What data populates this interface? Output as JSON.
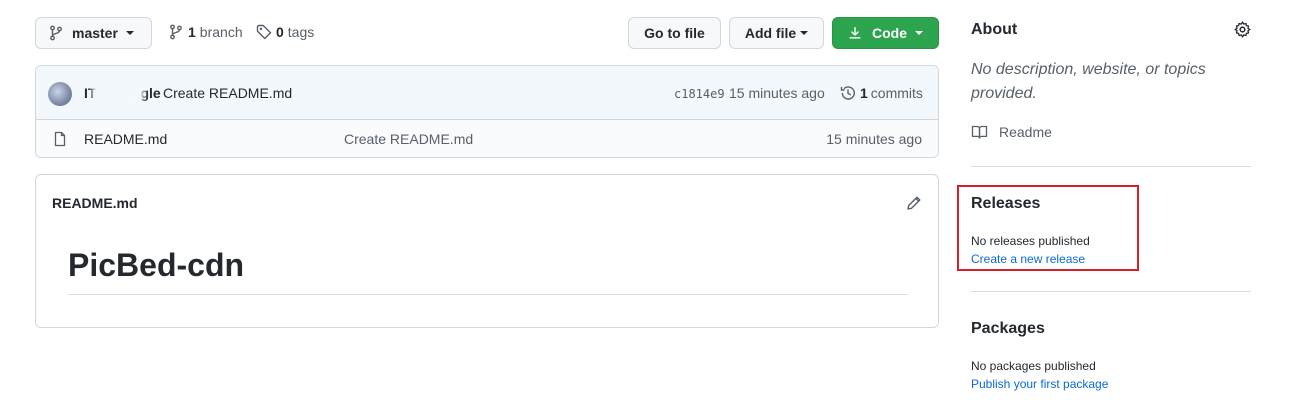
{
  "toolbar": {
    "branch_button": "master",
    "branches_count": "1",
    "branches_label": "branch",
    "tags_count": "0",
    "tags_label": "tags",
    "go_to_file": "Go to file",
    "add_file": "Add file",
    "code": "Code"
  },
  "commit": {
    "author_prefix": "IT",
    "author_suffix": "gle",
    "message": "Create README.md",
    "sha": "c1814e9",
    "time": "15 minutes ago",
    "commits_count": "1",
    "commits_label": "commits"
  },
  "files": [
    {
      "name": "README.md",
      "message": "Create README.md",
      "time": "15 minutes ago"
    }
  ],
  "readme": {
    "filename": "README.md",
    "heading": "PicBed-cdn"
  },
  "sidebar": {
    "about_title": "About",
    "about_desc": "No description, website, or topics provided.",
    "readme_link": "Readme",
    "releases_title": "Releases",
    "releases_text": "No releases published",
    "releases_link": "Create a new release",
    "packages_title": "Packages",
    "packages_text": "No packages published",
    "packages_link": "Publish your first package"
  },
  "colors": {
    "accent_green": "#2da44e",
    "link_blue": "#0969da",
    "highlight_red": "#d6202a"
  }
}
